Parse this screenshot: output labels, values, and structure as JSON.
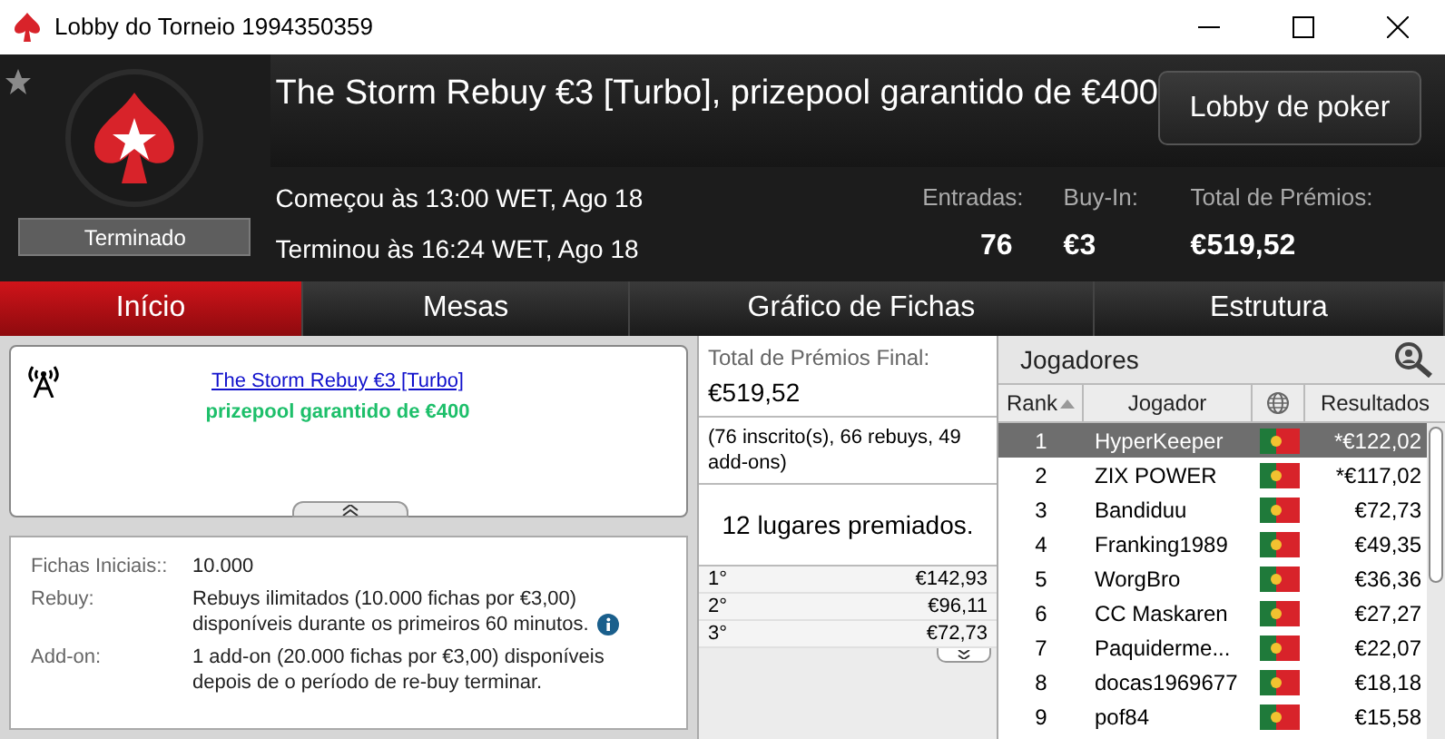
{
  "window": {
    "title": "Lobby do Torneio 1994350359"
  },
  "header": {
    "title": "The Storm Rebuy €3 [Turbo], prizepool garantido de €400",
    "lobby_button": "Lobby de poker",
    "status": "Terminado",
    "started": "Começou às 13:00 WET, Ago 18",
    "ended": "Terminou às 16:24 WET, Ago 18",
    "stats": [
      {
        "label": "Entradas:",
        "value": "76"
      },
      {
        "label": "Buy-In:",
        "value": "€3"
      },
      {
        "label": "Total de Prémios:",
        "value": "€519,52"
      }
    ]
  },
  "tabs": [
    {
      "label": "Início",
      "selected": true
    },
    {
      "label": "Mesas",
      "selected": false
    },
    {
      "label": "Gráfico de Fichas",
      "selected": false
    },
    {
      "label": "Estrutura",
      "selected": false
    }
  ],
  "news": {
    "link": "The Storm Rebuy €3 [Turbo]",
    "subtitle": "prizepool garantido de €400"
  },
  "details": [
    {
      "label": "Fichas Iniciais::",
      "value": "10.000",
      "info": false
    },
    {
      "label": "Rebuy:",
      "value": "Rebuys ilimitados (10.000 fichas por €3,00) disponíveis durante os primeiros 60 minutos.",
      "info": true
    },
    {
      "label": "Add-on:",
      "value": "1 add-on (20.000 fichas por €3,00) disponíveis depois de o período de re-buy terminar.",
      "info": false
    }
  ],
  "prizes": {
    "label": "Total de Prémios Final:",
    "amount": "€519,52",
    "note": "(76 inscrito(s), 66 rebuys, 49 add-ons)",
    "places": "12 lugares premiados.",
    "payouts": [
      {
        "place": "1°",
        "amount": "€142,93"
      },
      {
        "place": "2°",
        "amount": "€96,11"
      },
      {
        "place": "3°",
        "amount": "€72,73"
      }
    ]
  },
  "players": {
    "title": "Jogadores",
    "columns": [
      "Rank",
      "Jogador",
      "Resultados"
    ],
    "rows": [
      {
        "rank": "1",
        "name": "HyperKeeper",
        "result": "*€122,02",
        "selected": true
      },
      {
        "rank": "2",
        "name": "ZIX POWER",
        "result": "*€117,02",
        "selected": false
      },
      {
        "rank": "3",
        "name": "Bandiduu",
        "result": "€72,73",
        "selected": false
      },
      {
        "rank": "4",
        "name": "Franking1989",
        "result": "€49,35",
        "selected": false
      },
      {
        "rank": "5",
        "name": "WorgBro",
        "result": "€36,36",
        "selected": false
      },
      {
        "rank": "6",
        "name": "CC Maskaren",
        "result": "€27,27",
        "selected": false
      },
      {
        "rank": "7",
        "name": "Paquiderme...",
        "result": "€22,07",
        "selected": false
      },
      {
        "rank": "8",
        "name": "docas1969677",
        "result": "€18,18",
        "selected": false
      },
      {
        "rank": "9",
        "name": "pof84",
        "result": "€15,58",
        "selected": false
      }
    ]
  }
}
